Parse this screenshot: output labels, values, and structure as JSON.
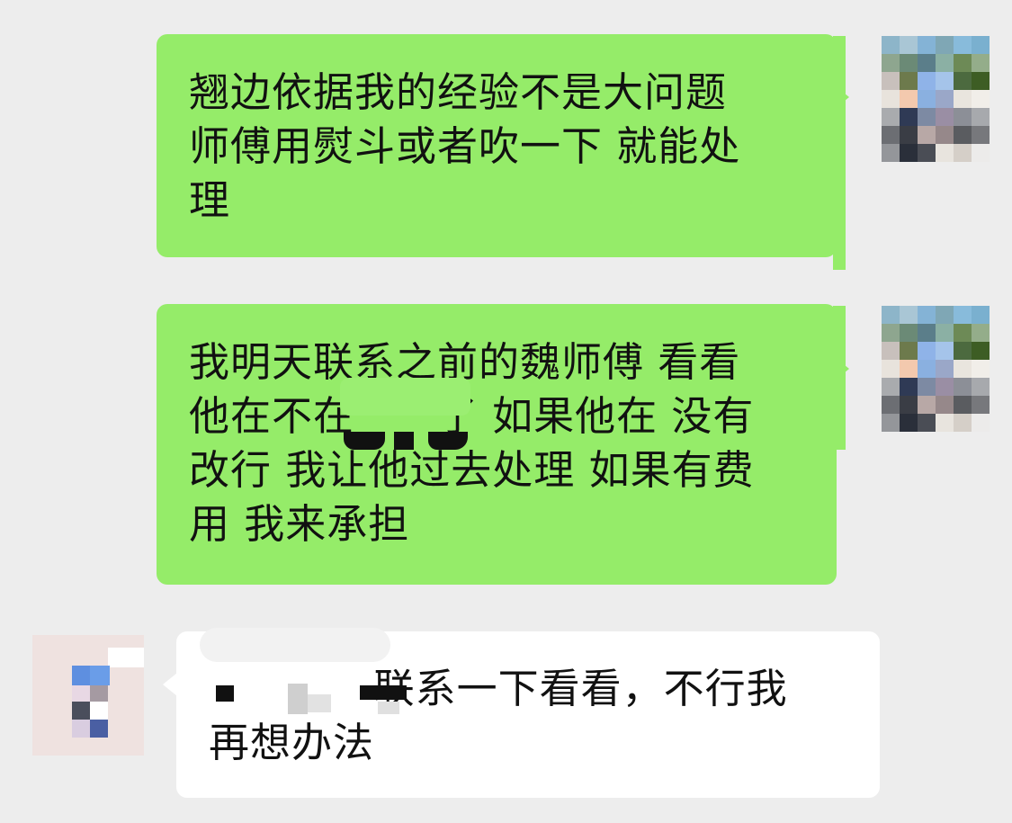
{
  "chat": {
    "messages": [
      {
        "sender": "me",
        "text": "翘边依据我的经验不是大问题\n师傅用熨斗或者吹一下 就能处\n理"
      },
      {
        "sender": "me",
        "text": "我明天联系之前的魏师傅 看看\n他在不在      了 如果他在 没有\n改行 我让他过去处理 如果有费\n用 我来承担"
      },
      {
        "sender": "other",
        "text": "            联系一下看看，不行我\n再想办法"
      }
    ]
  },
  "colors": {
    "background": "#ededed",
    "sent_bubble": "#95ec69",
    "received_bubble": "#ffffff",
    "text": "#111111"
  },
  "icons": {
    "my_avatar": "pixelated-avatar-icon",
    "other_avatar": "pixelated-avatar-icon"
  }
}
